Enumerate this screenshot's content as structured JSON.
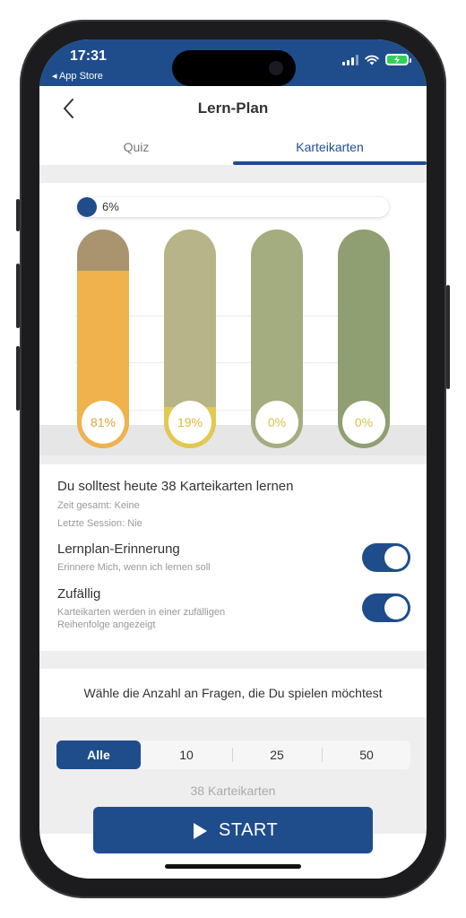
{
  "status_bar": {
    "time": "17:31",
    "back_app": "◂ App Store"
  },
  "nav": {
    "title": "Lern-Plan"
  },
  "tabs": [
    {
      "label": "Quiz",
      "active": false
    },
    {
      "label": "Karteikarten",
      "active": true
    }
  ],
  "progress": {
    "percent": 6,
    "label": "6%"
  },
  "chart_data": {
    "type": "bar",
    "categories": [
      "",
      "",
      "",
      ""
    ],
    "values": [
      81,
      19,
      0,
      0
    ],
    "labels": [
      "81%",
      "19%",
      "0%",
      "0%"
    ],
    "ylim": [
      0,
      100
    ],
    "colors": {
      "track": [
        "#a9946f",
        "#b6b488",
        "#a3ad80",
        "#8f9f72"
      ],
      "fill": [
        "#f0b24c",
        "#e2c94f",
        "#a3ad80",
        "#8f9f72"
      ],
      "text": [
        "#e3a53a",
        "#d8bd3c",
        "#d8c24a",
        "#d8c24a"
      ]
    }
  },
  "summary": {
    "headline": "Du solltest heute 38 Karteikarten lernen",
    "total_time": "Zeit gesamt: Keine",
    "last_session": "Letzte Session: Nie"
  },
  "settings": {
    "reminder": {
      "title": "Lernplan-Erinnerung",
      "description": "Erinnere Mich, wenn ich lernen soll",
      "enabled": true
    },
    "random": {
      "title": "Zufällig",
      "description": "Karteikarten werden in einer zufälligen Reihenfolge angezeigt",
      "enabled": true
    }
  },
  "question_select": {
    "prompt": "Wähle die Anzahl an Fragen, die Du spielen möchtest",
    "options": [
      "Alle",
      "10",
      "25",
      "50"
    ],
    "selected": "Alle",
    "count_text": "38 Karteikarten"
  },
  "start_button": {
    "label": "START"
  },
  "colors": {
    "primary": "#1f4d8c",
    "background": "#eeeeee"
  },
  "icons": {
    "back": "chevron-left-icon",
    "start": "play-icon",
    "signal": "cellular-signal-icon",
    "wifi": "wifi-icon",
    "battery": "battery-charging-icon"
  }
}
